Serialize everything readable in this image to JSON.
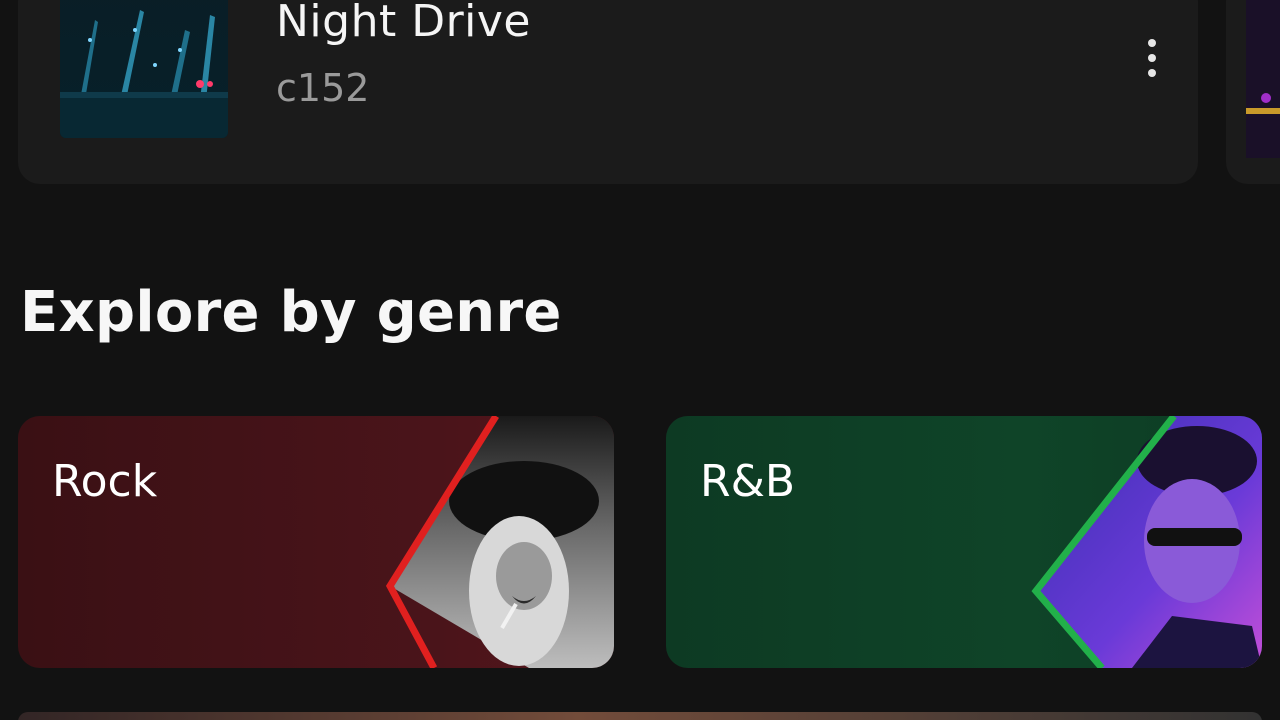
{
  "track": {
    "title": "Night Drive",
    "subtitle": "c152"
  },
  "icons": {
    "more": "more-vertical-icon"
  },
  "section": {
    "title": "Explore by genre"
  },
  "genres": [
    {
      "label": "Rock",
      "accent": "#e0201f",
      "background": "#3d1116"
    },
    {
      "label": "R&B",
      "accent": "#22b04a",
      "background": "#0e3f26"
    }
  ]
}
